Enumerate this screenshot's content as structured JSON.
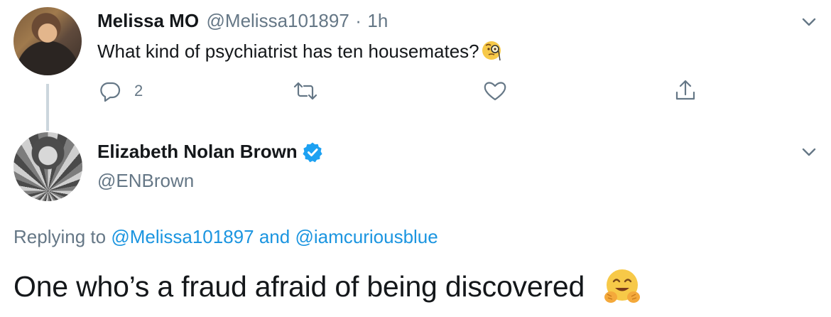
{
  "tweet1": {
    "author_name": "Melissa MO",
    "author_handle": "@Melissa101897",
    "separator": "·",
    "time": "1h",
    "text": "What kind of psychiatrist has ten housemates?",
    "text_emoji": "face-with-monocle",
    "reply_count": "2"
  },
  "tweet2": {
    "author_name": "Elizabeth Nolan Brown",
    "author_handle": "@ENBrown",
    "verified": true,
    "replying_prefix": "Replying to",
    "replying_mention_1": "@Melissa101897",
    "replying_and": "and",
    "replying_mention_2": "@iamcuriousblue",
    "text": "One who’s a fraud afraid of being discovered",
    "text_emoji": "hugging-face"
  },
  "colors": {
    "link": "#1b95e0",
    "secondary_text": "#657786",
    "primary_text": "#14171a",
    "verified": "#1da1f2",
    "thread_line": "#ccd6dd"
  },
  "icons": [
    "chevron-down-icon",
    "reply-icon",
    "retweet-icon",
    "like-icon",
    "share-icon",
    "verified-badge-icon"
  ]
}
